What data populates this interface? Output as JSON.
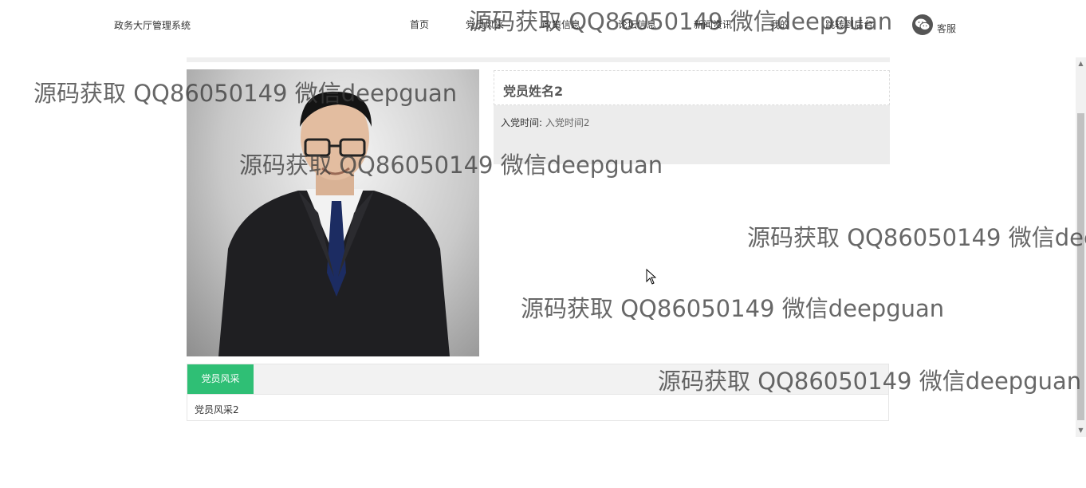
{
  "header": {
    "brand": "政务大厅管理系统",
    "nav": [
      "首页",
      "党员风采",
      "政策信息",
      "论坛信息",
      "新闻资讯",
      "我的",
      "跳转到后台"
    ],
    "service_label": "客服",
    "service_icon": "wechat-icon"
  },
  "member": {
    "name": "党员姓名2",
    "join_label": "入党时间:",
    "join_value": "入党时间2"
  },
  "tab": {
    "label": "党员风采",
    "content": "党员风采2",
    "accent": "#2fbf75"
  },
  "watermark": "源码获取 QQ86050149 微信deepguan"
}
